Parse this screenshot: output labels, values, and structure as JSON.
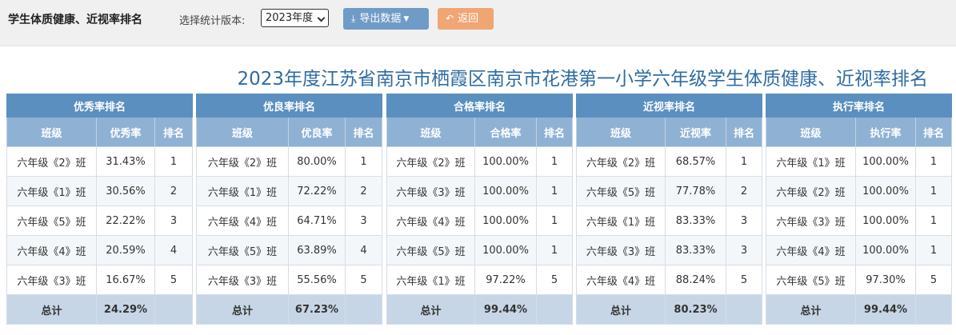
{
  "header": {
    "page_title": "学生体质健康、近视率排名",
    "version_label": "选择统计版本:",
    "version_selected": "2023年度",
    "export_label": "导出数据",
    "back_label": "返回"
  },
  "report_title": "2023年度江苏省南京市栖霞区南京市花港第一小学六年级学生体质健康、近视率排名",
  "panels": [
    {
      "title": "优秀率排名",
      "col_class": "班级",
      "col_rate": "优秀率",
      "col_rank": "排名",
      "rows": [
        {
          "class": "六年级《2》班",
          "rate": "31.43%",
          "rank": "1"
        },
        {
          "class": "六年级《1》班",
          "rate": "30.56%",
          "rank": "2"
        },
        {
          "class": "六年级《5》班",
          "rate": "22.22%",
          "rank": "3"
        },
        {
          "class": "六年级《4》班",
          "rate": "20.59%",
          "rank": "4"
        },
        {
          "class": "六年级《3》班",
          "rate": "16.67%",
          "rank": "5"
        }
      ],
      "total_label": "总计",
      "total_rate": "24.29%"
    },
    {
      "title": "优良率排名",
      "col_class": "班级",
      "col_rate": "优良率",
      "col_rank": "排名",
      "rows": [
        {
          "class": "六年级《2》班",
          "rate": "80.00%",
          "rank": "1"
        },
        {
          "class": "六年级《1》班",
          "rate": "72.22%",
          "rank": "2"
        },
        {
          "class": "六年级《4》班",
          "rate": "64.71%",
          "rank": "3"
        },
        {
          "class": "六年级《5》班",
          "rate": "63.89%",
          "rank": "4"
        },
        {
          "class": "六年级《3》班",
          "rate": "55.56%",
          "rank": "5"
        }
      ],
      "total_label": "总计",
      "total_rate": "67.23%"
    },
    {
      "title": "合格率排名",
      "col_class": "班级",
      "col_rate": "合格率",
      "col_rank": "排名",
      "rows": [
        {
          "class": "六年级《2》班",
          "rate": "100.00%",
          "rank": "1"
        },
        {
          "class": "六年级《3》班",
          "rate": "100.00%",
          "rank": "1"
        },
        {
          "class": "六年级《4》班",
          "rate": "100.00%",
          "rank": "1"
        },
        {
          "class": "六年级《5》班",
          "rate": "100.00%",
          "rank": "1"
        },
        {
          "class": "六年级《1》班",
          "rate": "97.22%",
          "rank": "5"
        }
      ],
      "total_label": "总计",
      "total_rate": "99.44%"
    },
    {
      "title": "近视率排名",
      "col_class": "班级",
      "col_rate": "近视率",
      "col_rank": "排名",
      "rows": [
        {
          "class": "六年级《2》班",
          "rate": "68.57%",
          "rank": "1"
        },
        {
          "class": "六年级《5》班",
          "rate": "77.78%",
          "rank": "2"
        },
        {
          "class": "六年级《1》班",
          "rate": "83.33%",
          "rank": "3"
        },
        {
          "class": "六年级《3》班",
          "rate": "83.33%",
          "rank": "3"
        },
        {
          "class": "六年级《4》班",
          "rate": "88.24%",
          "rank": "5"
        }
      ],
      "total_label": "总计",
      "total_rate": "80.23%"
    },
    {
      "title": "执行率排名",
      "col_class": "班级",
      "col_rate": "执行率",
      "col_rank": "排名",
      "rows": [
        {
          "class": "六年级《1》班",
          "rate": "100.00%",
          "rank": "1"
        },
        {
          "class": "六年级《2》班",
          "rate": "100.00%",
          "rank": "1"
        },
        {
          "class": "六年级《3》班",
          "rate": "100.00%",
          "rank": "1"
        },
        {
          "class": "六年级《4》班",
          "rate": "100.00%",
          "rank": "1"
        },
        {
          "class": "六年级《5》班",
          "rate": "97.30%",
          "rank": "5"
        }
      ],
      "total_label": "总计",
      "total_rate": "99.44%"
    }
  ],
  "icons": {
    "export": "download-icon",
    "export_caret": "caret-down-icon",
    "back": "back-arrow-icon",
    "select_caret": "chevron-down-icon"
  }
}
